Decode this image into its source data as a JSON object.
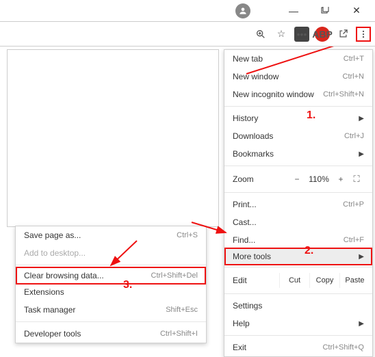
{
  "window": {
    "profile": "●"
  },
  "toolbar": {
    "abp": "ABP",
    "sq": "•••"
  },
  "menu": {
    "new_tab": "New tab",
    "new_tab_sc": "Ctrl+T",
    "new_window": "New window",
    "new_window_sc": "Ctrl+N",
    "new_incognito": "New incognito window",
    "new_incognito_sc": "Ctrl+Shift+N",
    "history": "History",
    "downloads": "Downloads",
    "downloads_sc": "Ctrl+J",
    "bookmarks": "Bookmarks",
    "zoom_label": "Zoom",
    "zoom_value": "110%",
    "zoom_minus": "−",
    "zoom_plus": "+",
    "print": "Print...",
    "print_sc": "Ctrl+P",
    "cast": "Cast...",
    "find": "Find...",
    "find_sc": "Ctrl+F",
    "more_tools": "More tools",
    "edit_label": "Edit",
    "cut": "Cut",
    "copy": "Copy",
    "paste": "Paste",
    "settings": "Settings",
    "help": "Help",
    "exit": "Exit",
    "exit_sc": "Ctrl+Shift+Q"
  },
  "submenu": {
    "save_page": "Save page as...",
    "save_page_sc": "Ctrl+S",
    "add_desktop": "Add to desktop...",
    "clear_data": "Clear browsing data...",
    "clear_data_sc": "Ctrl+Shift+Del",
    "extensions": "Extensions",
    "task_manager": "Task manager",
    "task_manager_sc": "Shift+Esc",
    "dev_tools": "Developer tools",
    "dev_tools_sc": "Ctrl+Shift+I"
  },
  "annotations": {
    "one": "1.",
    "two": "2.",
    "three": "3."
  }
}
